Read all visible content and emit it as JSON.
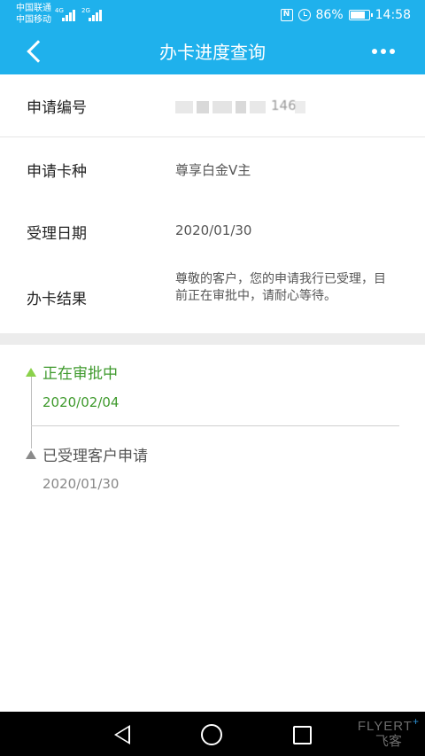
{
  "status_bar": {
    "carrier_1": "中国联通",
    "carrier_2": "中国移动",
    "network_1": "4G",
    "network_2": "2G",
    "battery_percent": "86%",
    "battery_level": 0.86,
    "time": "14:58",
    "icons": [
      "nfc-icon",
      "alarm-icon",
      "battery-icon"
    ]
  },
  "header": {
    "title": "办卡进度查询",
    "back_icon": "chevron-left-icon",
    "more_icon": "more-horizontal-icon"
  },
  "application": {
    "number_label": "申请编号",
    "number_value_visible": "146",
    "card_type_label": "申请卡种",
    "card_type_value": "尊享白金V主",
    "date_label": "受理日期",
    "date_value": "2020/01/30",
    "result_label": "办卡结果",
    "result_value": "尊敬的客户，您的申请我行已受理，目前正在审批中，请耐心等待。"
  },
  "timeline": [
    {
      "title": "正在审批中",
      "date": "2020/02/04",
      "color": "#3f9a2d",
      "marker": "#8bd14b"
    },
    {
      "title": "已受理客户申请",
      "date": "2020/01/30",
      "color": "#555555",
      "marker": "#8a8a8a"
    }
  ],
  "nav_bar": {
    "icons": [
      "back-triangle-icon",
      "home-circle-icon",
      "recent-square-icon"
    ]
  },
  "watermark": {
    "text_en": "FLYERT",
    "plus": "+",
    "text_cn": "飞客"
  },
  "colors": {
    "accent": "#1fb1ec",
    "status_green": "#3f9a2d"
  }
}
